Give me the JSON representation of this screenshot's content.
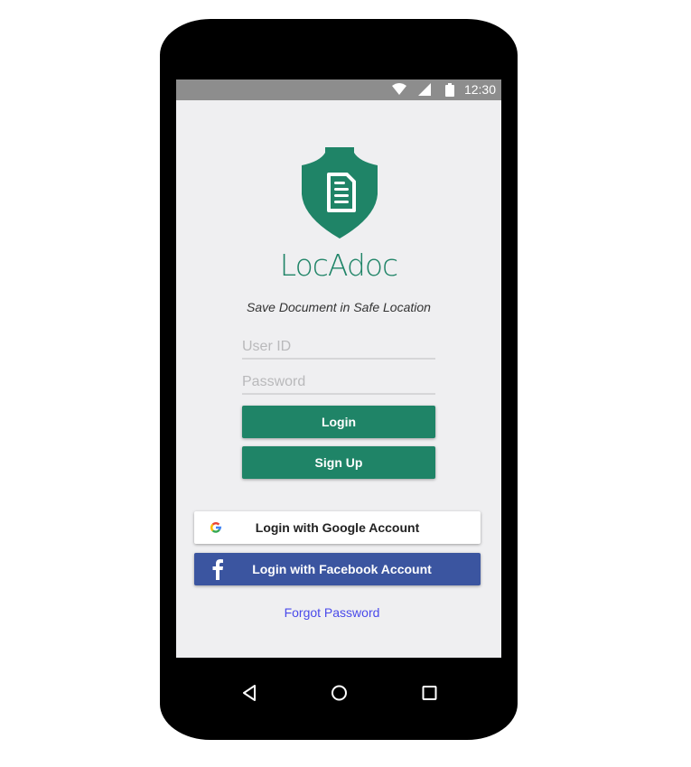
{
  "status_bar": {
    "time": "12:30",
    "icons": [
      "wifi-icon",
      "signal-icon",
      "battery-icon"
    ]
  },
  "app": {
    "logo_icon": "shield-document-icon",
    "brand_name": "LocAdoc",
    "tagline": "Save Document in Safe Location"
  },
  "form": {
    "user_id_placeholder": "User ID",
    "user_id_value": "",
    "password_placeholder": "Password",
    "password_value": "",
    "login_label": "Login",
    "signup_label": "Sign Up"
  },
  "social": {
    "google_label": "Login with Google Account",
    "google_icon": "google-icon",
    "facebook_label": "Login with Facebook Account",
    "facebook_icon": "facebook-icon"
  },
  "forgot_password": "Forgot Password",
  "nav_bar": {
    "buttons": [
      "back-icon",
      "home-icon",
      "recents-icon"
    ]
  },
  "colors": {
    "brand_green": "#1f8467",
    "facebook_blue": "#3b55a0",
    "link_blue": "#4a4aea",
    "screen_bg": "#efeff1",
    "status_bar": "#8d8d8d"
  }
}
